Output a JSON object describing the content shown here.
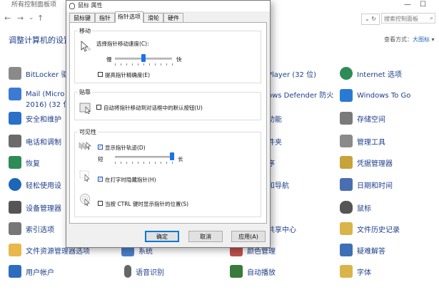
{
  "control_panel": {
    "window_title": "所有控制面板项",
    "search_placeholder": "搜索控制面板",
    "heading": "调整计算机的设置",
    "view_by_label": "查看方式：",
    "view_by_value": "大图标",
    "items": [
      {
        "label": "BitLocker 驱",
        "icon": "bitlocker-icon",
        "color": "#8a8a8a"
      },
      {
        "label": "Mail (Micro",
        "icon": "mail-icon",
        "color": "#3b7bd4"
      },
      {
        "label": "2016) (32 位",
        "icon": "",
        "color": ""
      },
      {
        "label": "安全和维护",
        "icon": "flag-icon",
        "color": "#2a6fc9"
      },
      {
        "label": "电话和调制",
        "icon": "phone-icon",
        "color": "#6b6b6b"
      },
      {
        "label": "恢复",
        "icon": "recovery-icon",
        "color": "#2e8b57"
      },
      {
        "label": "轻松使用设",
        "icon": "ease-of-access-icon",
        "color": "#1e66b8"
      },
      {
        "label": "设备管理器",
        "icon": "device-manager-icon",
        "color": "#555555"
      },
      {
        "label": "索引选项",
        "icon": "indexing-icon",
        "color": "#777777"
      },
      {
        "label": "文件资源管理器选项",
        "icon": "folder-options-icon",
        "color": "#e8b84a"
      },
      {
        "label": "用户帐户",
        "icon": "users-icon",
        "color": "#2e6cc0"
      },
      {
        "label": "Player (32 位)",
        "icon": "",
        "color": ""
      },
      {
        "label": "ows Defender 防火",
        "icon": "",
        "color": ""
      },
      {
        "label": "功能",
        "icon": "",
        "color": ""
      },
      {
        "label": "件夹",
        "icon": "",
        "color": ""
      },
      {
        "label": "序",
        "icon": "",
        "color": ""
      },
      {
        "label": "和导航",
        "icon": "",
        "color": ""
      },
      {
        "label": "共享中心",
        "icon": "",
        "color": ""
      },
      {
        "label": "系统",
        "icon": "system-icon",
        "color": "#4a7fc9"
      },
      {
        "label": "颜色管理",
        "icon": "color-management-icon",
        "color": "#c0504d"
      },
      {
        "label": "语音识别",
        "icon": "microphone-icon",
        "color": "#666666"
      },
      {
        "label": "自动播放",
        "icon": "autoplay-icon",
        "color": "#3a7a3a"
      },
      {
        "label": "Internet 选项",
        "icon": "internet-options-icon",
        "color": "#2e8b57"
      },
      {
        "label": "Windows To Go",
        "icon": "windows-to-go-icon",
        "color": "#2a7ad4"
      },
      {
        "label": "存储空间",
        "icon": "storage-spaces-icon",
        "color": "#7a7a7a"
      },
      {
        "label": "管理工具",
        "icon": "admin-tools-icon",
        "color": "#8a8a8a"
      },
      {
        "label": "凭据管理器",
        "icon": "credential-manager-icon",
        "color": "#c8a23a"
      },
      {
        "label": "日期和时间",
        "icon": "clock-icon",
        "color": "#4a6fb0"
      },
      {
        "label": "鼠标",
        "icon": "mouse-icon",
        "color": "#555555"
      },
      {
        "label": "文件历史记录",
        "icon": "file-history-icon",
        "color": "#d9b44a"
      },
      {
        "label": "疑难解答",
        "icon": "troubleshoot-icon",
        "color": "#3d6fb6"
      },
      {
        "label": "字体",
        "icon": "fonts-icon",
        "color": "#d9b44a"
      }
    ]
  },
  "dialog": {
    "title": "鼠标 属性",
    "tabs": [
      "鼠标键",
      "指针",
      "指针选项",
      "滑轮",
      "硬件"
    ],
    "active_tab": "指针选项",
    "motion": {
      "group_label": "移动",
      "speed_label": "选择指针移动速度(C):",
      "slow_label": "慢",
      "fast_label": "快",
      "speed_level_fraction": 0.5,
      "precision_label": "提高指针精确度(E)",
      "precision_checked": false
    },
    "snap": {
      "group_label": "贴靠",
      "snap_label": "自动将指针移动到对话框中的默认按钮(U)",
      "snap_checked": false
    },
    "visibility": {
      "group_label": "可见性",
      "trails_label": "显示指针轨迹(D)",
      "trails_checked": true,
      "short_label": "短",
      "long_label": "长",
      "trail_length_fraction": 0.97,
      "hide_label": "在打字时隐藏指针(H)",
      "hide_checked": true,
      "ctrl_label": "当按 CTRL 键时显示指针的位置(S)",
      "ctrl_checked": false
    },
    "buttons": {
      "ok": "确定",
      "cancel": "取消",
      "apply": "应用(A)"
    }
  }
}
